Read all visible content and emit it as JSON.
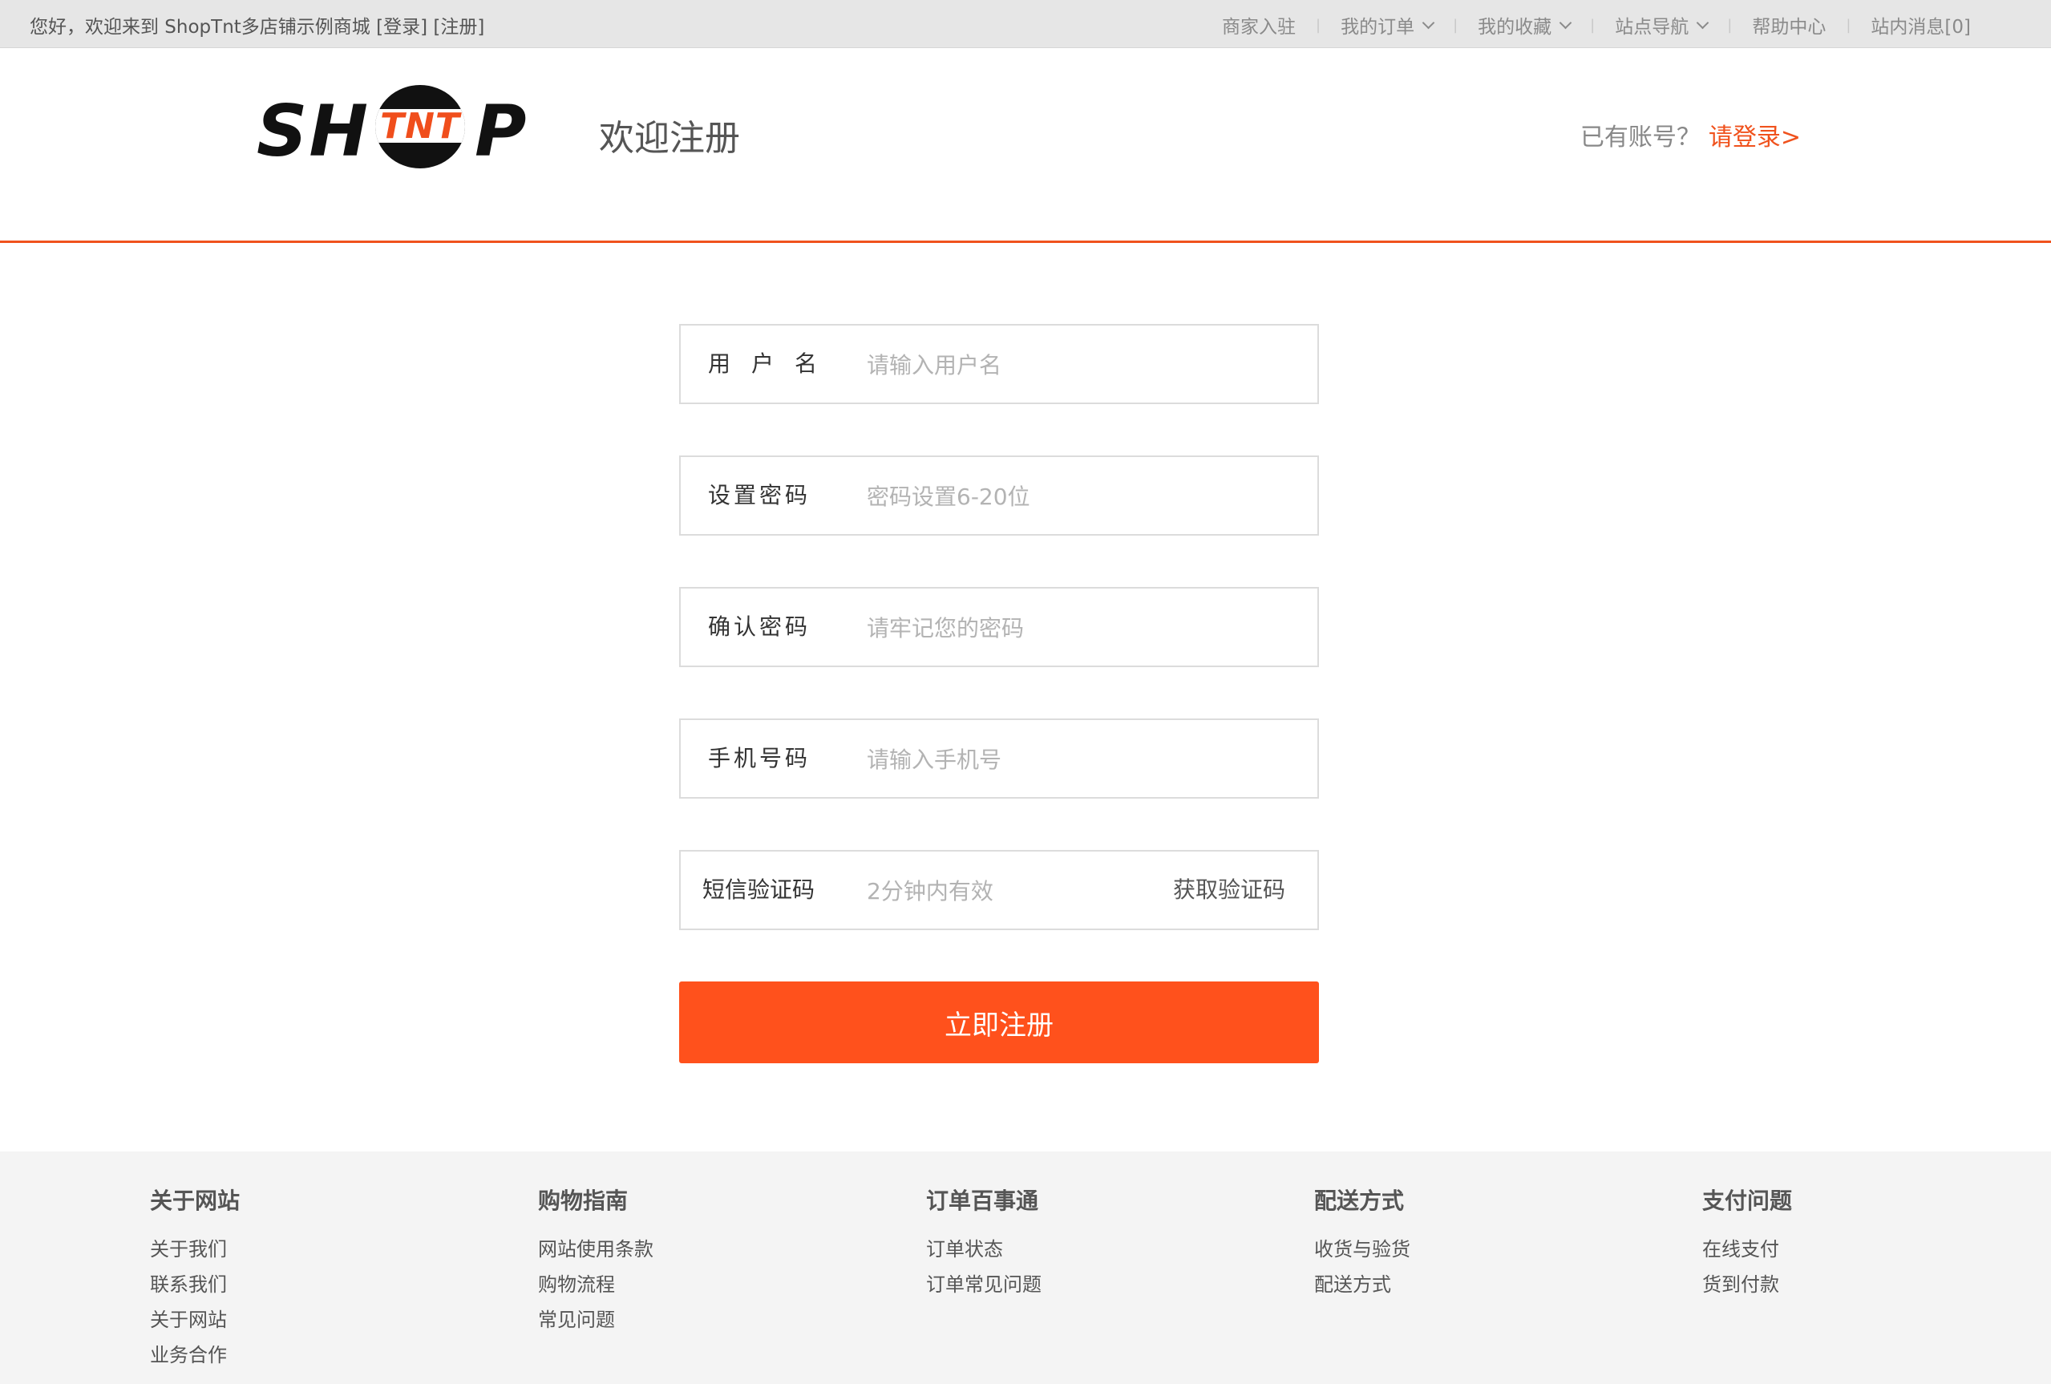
{
  "topbar": {
    "greeting": "您好，欢迎来到 ShopTnt多店铺示例商城",
    "login": "[登录]",
    "register": "[注册]",
    "nav": {
      "merchant": "商家入驻",
      "orders": "我的订单",
      "favorites": "我的收藏",
      "site_nav": "站点导航",
      "help": "帮助中心",
      "messages": "站内消息[0]"
    }
  },
  "header": {
    "logo": {
      "left": "SH",
      "middle": "TNT",
      "right": "P"
    },
    "title": "欢迎注册",
    "have_account": "已有账号？",
    "login_link": "请登录>"
  },
  "form": {
    "username": {
      "label": "用户名",
      "placeholder": "请输入用户名"
    },
    "password": {
      "label": "设置密码",
      "placeholder": "密码设置6-20位"
    },
    "confirm": {
      "label": "确认密码",
      "placeholder": "请牢记您的密码"
    },
    "phone": {
      "label": "手机号码",
      "placeholder": "请输入手机号"
    },
    "sms": {
      "label": "短信验证码",
      "placeholder": "2分钟内有效",
      "get_code": "获取验证码"
    },
    "submit": "立即注册"
  },
  "footer": {
    "columns": [
      {
        "title": "关于网站",
        "links": [
          "关于我们",
          "联系我们",
          "关于网站",
          "业务合作"
        ]
      },
      {
        "title": "购物指南",
        "links": [
          "网站使用条款",
          "购物流程",
          "常见问题"
        ]
      },
      {
        "title": "订单百事通",
        "links": [
          "订单状态",
          "订单常见问题"
        ]
      },
      {
        "title": "配送方式",
        "links": [
          "收货与验货",
          "配送方式"
        ]
      },
      {
        "title": "支付问题",
        "links": [
          "在线支付",
          "货到付款"
        ]
      }
    ]
  },
  "colors": {
    "accent": "#ff511c",
    "topbar_bg": "#e6e6e6",
    "footer_bg": "#f4f4f4"
  }
}
